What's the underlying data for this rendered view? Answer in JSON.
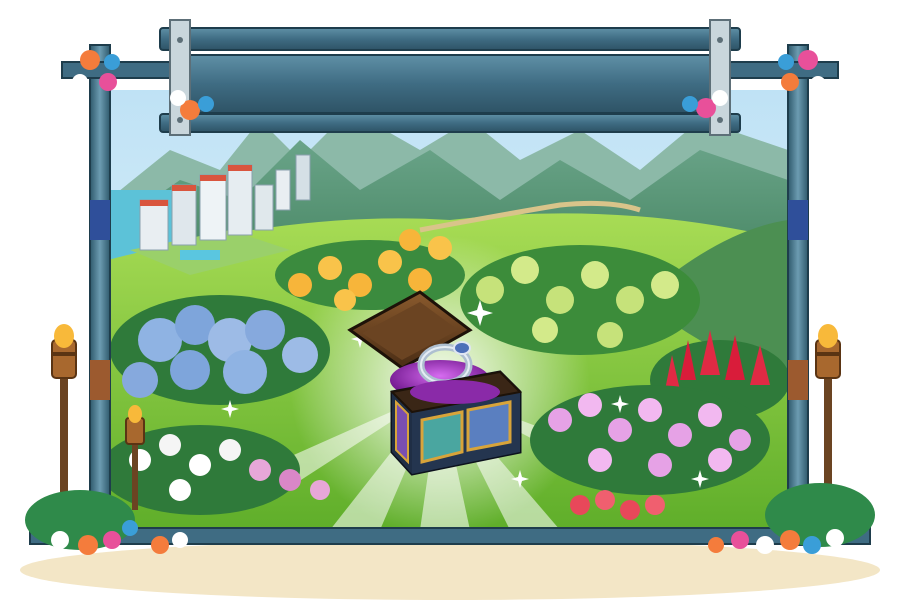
{
  "screen": {
    "kind": "game-reward-splash",
    "title_text": "",
    "reward": {
      "item": "treasure-chest-with-ring",
      "chest_state": "open"
    },
    "decorations": {
      "frame": "wooden-bamboo-frame",
      "signboard": "empty-plank-sign",
      "torches": 3,
      "corner_flowers": 6
    },
    "scenery": {
      "background": "tropical-valley-with-mountains",
      "buildings": "resort-hotel-complex",
      "crop_fields": [
        "blue-hydrangea",
        "yellow-hibiscus",
        "green-hops",
        "red-ginger",
        "pink-orchid",
        "white-orchid"
      ]
    },
    "colors": {
      "frame_wood": "#3f6c83",
      "frame_wood_light": "#7aa8bd",
      "sign_plank": "#4a7a91",
      "sky": "#cfe9f7",
      "grass": "#8fd13f",
      "chest_wood": "#5a3a1f",
      "chest_gem": "#8a2aa8",
      "sand": "#f3e6c6"
    }
  }
}
